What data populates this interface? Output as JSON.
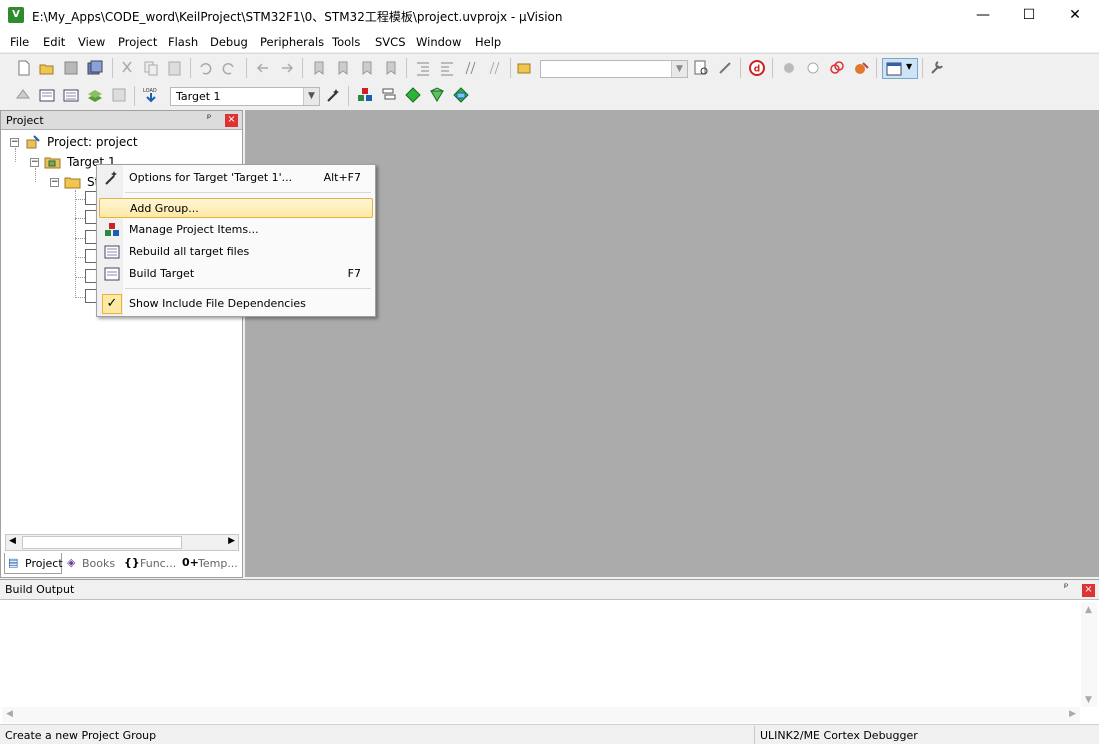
{
  "window": {
    "title": "E:\\My_Apps\\CODE_word\\KeilProject\\STM32F1\\0、STM32工程模板\\project.uvprojx - µVision",
    "app_icon_label": "V",
    "minimize": "—",
    "maximize": "☐",
    "close": "✕"
  },
  "menu": [
    "File",
    "Edit",
    "View",
    "Project",
    "Flash",
    "Debug",
    "Peripherals",
    "Tools",
    "SVCS",
    "Window",
    "Help"
  ],
  "toolbar2": {
    "target_select": "Target 1"
  },
  "project_panel": {
    "title": "Project",
    "pin": "ᵖ",
    "close": "×",
    "tree": {
      "root": "Project: project",
      "target": "Target 1",
      "group_partial": "St"
    },
    "tabs": [
      {
        "icon": "▤",
        "label": "Project"
      },
      {
        "icon": "◈",
        "label": "Books"
      },
      {
        "icon": "{}",
        "label": "Func..."
      },
      {
        "icon": "0+",
        "label": "Temp..."
      }
    ]
  },
  "context_menu": {
    "items": [
      {
        "label": "Options for Target 'Target 1'...",
        "shortcut": "Alt+F7"
      },
      {
        "label": "Add Group...",
        "shortcut": ""
      },
      {
        "label": "Manage Project Items...",
        "shortcut": ""
      },
      {
        "label": "Rebuild all target files",
        "shortcut": ""
      },
      {
        "label": "Build Target",
        "shortcut": "F7"
      },
      {
        "label": "Show Include File Dependencies",
        "shortcut": "",
        "checked": "✓"
      }
    ]
  },
  "build_output": {
    "title": "Build Output",
    "pin": "ᵖ",
    "close": "×"
  },
  "statusbar": {
    "message": "Create a new Project Group",
    "debugger": "ULINK2/ME Cortex Debugger"
  }
}
